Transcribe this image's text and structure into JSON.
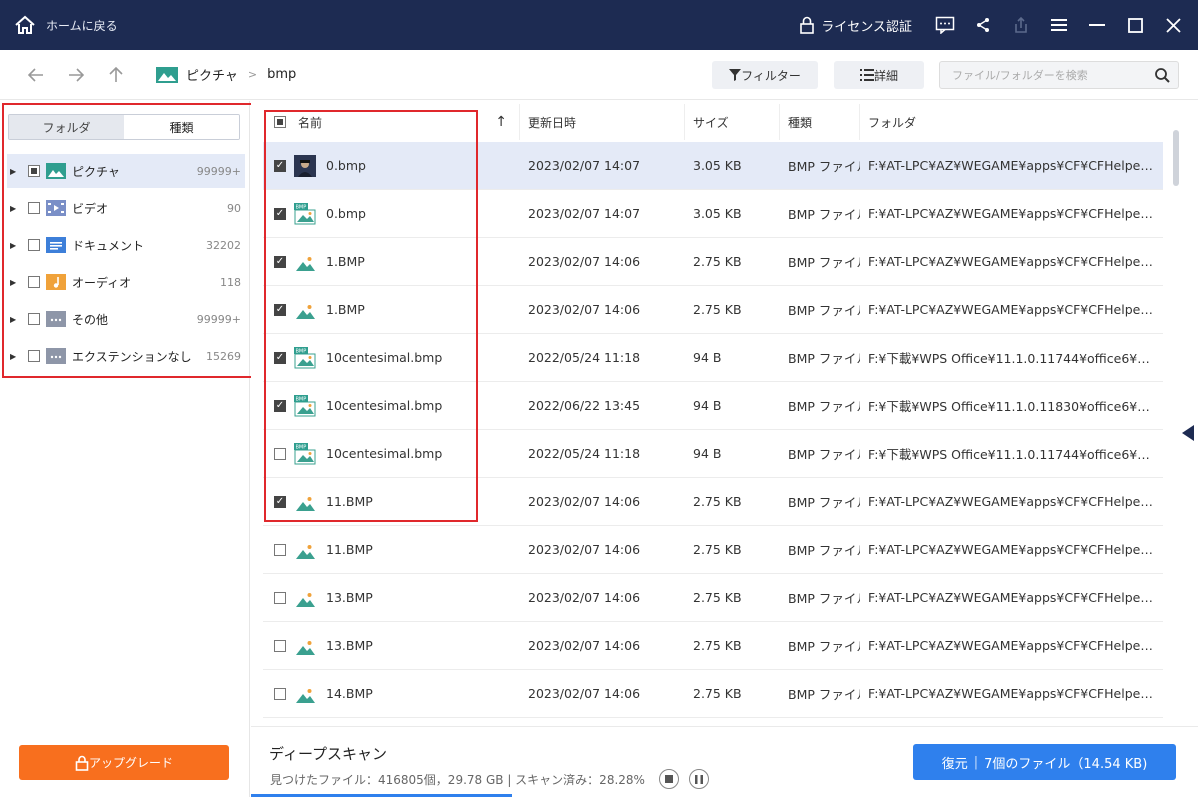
{
  "titlebar": {
    "home_label": "ホームに戻る",
    "license_label": "ライセンス認証"
  },
  "nav": {
    "breadcrumb": [
      "ピクチャ",
      "bmp"
    ],
    "filter_label": "フィルター",
    "detail_label": "詳細",
    "search_placeholder": "ファイル/フォルダーを検索"
  },
  "sidebar": {
    "tabs": [
      "フォルダ",
      "種類"
    ],
    "active_tab": "種類",
    "categories": [
      {
        "label": "ピクチャ",
        "count": "99999+",
        "state": "partial"
      },
      {
        "label": "ビデオ",
        "count": "90",
        "state": "unchecked"
      },
      {
        "label": "ドキュメント",
        "count": "32202",
        "state": "unchecked"
      },
      {
        "label": "オーディオ",
        "count": "118",
        "state": "unchecked"
      },
      {
        "label": "その他",
        "count": "99999+",
        "state": "unchecked"
      },
      {
        "label": "エクステンションなし",
        "count": "15269",
        "state": "unchecked"
      }
    ],
    "upgrade_label": "アップグレード"
  },
  "table": {
    "headers": {
      "name": "名前",
      "sort": "↑",
      "date": "更新日時",
      "size": "サイズ",
      "type": "種類",
      "folder": "フォルダ"
    },
    "rows": [
      {
        "name": "0.bmp",
        "date": "2023/02/07 14:07",
        "size": "3.05 KB",
        "type": "BMP ファイル",
        "folder": "F:¥AT-LPC¥AZ¥WEGAME¥apps¥CF¥CFHelpe…",
        "checked": true,
        "icon": "photo-thumb"
      },
      {
        "name": "0.bmp",
        "date": "2023/02/07 14:07",
        "size": "3.05 KB",
        "type": "BMP ファイル",
        "folder": "F:¥AT-LPC¥AZ¥WEGAME¥apps¥CF¥CFHelpe…",
        "checked": true,
        "icon": "bmp-image"
      },
      {
        "name": "1.BMP",
        "date": "2023/02/07 14:06",
        "size": "2.75 KB",
        "type": "BMP ファイル",
        "folder": "F:¥AT-LPC¥AZ¥WEGAME¥apps¥CF¥CFHelpe…",
        "checked": true,
        "icon": "image"
      },
      {
        "name": "1.BMP",
        "date": "2023/02/07 14:06",
        "size": "2.75 KB",
        "type": "BMP ファイル",
        "folder": "F:¥AT-LPC¥AZ¥WEGAME¥apps¥CF¥CFHelpe…",
        "checked": true,
        "icon": "image"
      },
      {
        "name": "10centesimal.bmp",
        "date": "2022/05/24 11:18",
        "size": "94 B",
        "type": "BMP ファイル",
        "folder": "F:¥下載¥WPS Office¥11.1.0.11744¥office6¥…",
        "checked": true,
        "icon": "bmp-image"
      },
      {
        "name": "10centesimal.bmp",
        "date": "2022/06/22 13:45",
        "size": "94 B",
        "type": "BMP ファイル",
        "folder": "F:¥下載¥WPS Office¥11.1.0.11830¥office6¥…",
        "checked": true,
        "icon": "bmp-image"
      },
      {
        "name": "10centesimal.bmp",
        "date": "2022/05/24 11:18",
        "size": "94 B",
        "type": "BMP ファイル",
        "folder": "F:¥下載¥WPS Office¥11.1.0.11744¥office6¥…",
        "checked": false,
        "icon": "bmp-image"
      },
      {
        "name": "11.BMP",
        "date": "2023/02/07 14:06",
        "size": "2.75 KB",
        "type": "BMP ファイル",
        "folder": "F:¥AT-LPC¥AZ¥WEGAME¥apps¥CF¥CFHelpe…",
        "checked": true,
        "icon": "image"
      },
      {
        "name": "11.BMP",
        "date": "2023/02/07 14:06",
        "size": "2.75 KB",
        "type": "BMP ファイル",
        "folder": "F:¥AT-LPC¥AZ¥WEGAME¥apps¥CF¥CFHelpe…",
        "checked": false,
        "icon": "image"
      },
      {
        "name": "13.BMP",
        "date": "2023/02/07 14:06",
        "size": "2.75 KB",
        "type": "BMP ファイル",
        "folder": "F:¥AT-LPC¥AZ¥WEGAME¥apps¥CF¥CFHelpe…",
        "checked": false,
        "icon": "image"
      },
      {
        "name": "13.BMP",
        "date": "2023/02/07 14:06",
        "size": "2.75 KB",
        "type": "BMP ファイル",
        "folder": "F:¥AT-LPC¥AZ¥WEGAME¥apps¥CF¥CFHelpe…",
        "checked": false,
        "icon": "image"
      },
      {
        "name": "14.BMP",
        "date": "2023/02/07 14:06",
        "size": "2.75 KB",
        "type": "BMP ファイル",
        "folder": "F:¥AT-LPC¥AZ¥WEGAME¥apps¥CF¥CFHelpe…",
        "checked": false,
        "icon": "image"
      }
    ]
  },
  "status": {
    "title": "ディープスキャン",
    "info": "見つけたファイル：416805個，29.78 GB | スキャン済み：28.28%",
    "progress_percent": 28.28
  },
  "recover": {
    "label": "復元",
    "detail": "7個のファイル（14.54 KB)"
  },
  "colors": {
    "titlebar": "#1d2b52",
    "accent": "#2f80ed",
    "upgrade": "#f86f1e",
    "highlight_box": "#e0282c",
    "selected_row": "#e4eaf7"
  }
}
